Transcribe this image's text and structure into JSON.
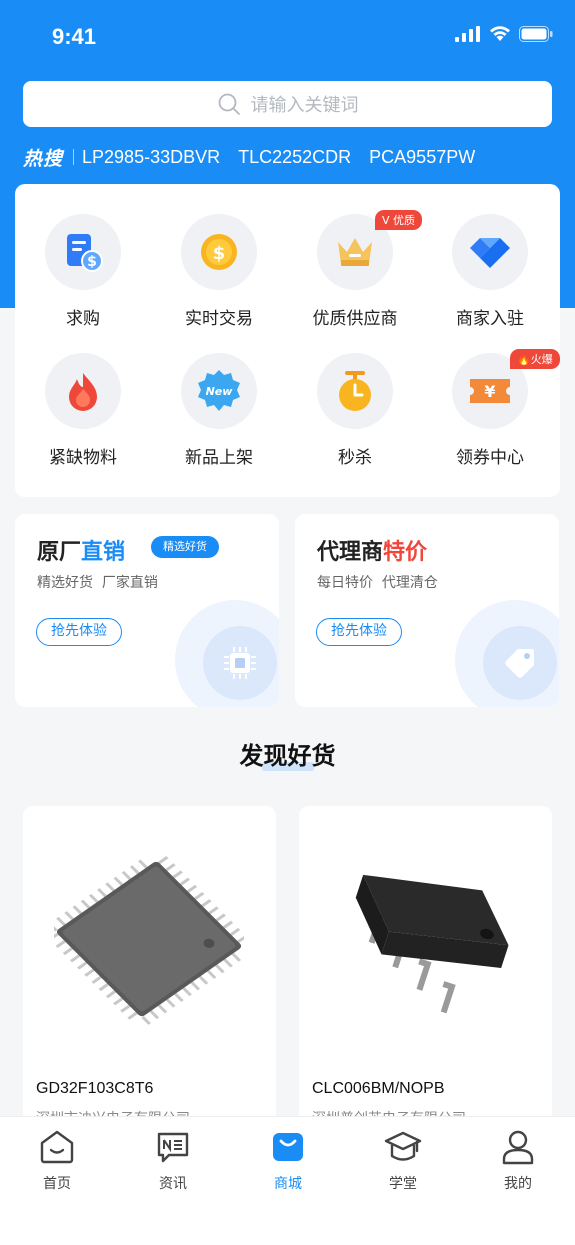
{
  "status": {
    "time": "9:41"
  },
  "search": {
    "placeholder": "请输入关键词"
  },
  "hot": {
    "label": "热搜",
    "items": [
      "LP2985-33DBVR",
      "TLC2252CDR",
      "PCA9557PW"
    ]
  },
  "categories": [
    {
      "label": "求购",
      "icon": "purchase-doc-icon"
    },
    {
      "label": "实时交易",
      "icon": "coin-icon"
    },
    {
      "label": "优质供应商",
      "icon": "crown-icon",
      "badge": "V 优质"
    },
    {
      "label": "商家入驻",
      "icon": "diamond-icon"
    },
    {
      "label": "紧缺物料",
      "icon": "flame-icon"
    },
    {
      "label": "新品上架",
      "icon": "new-badge-icon",
      "icon_text": "New"
    },
    {
      "label": "秒杀",
      "icon": "stopwatch-icon"
    },
    {
      "label": "领券中心",
      "icon": "coupon-icon",
      "badge": "火爆",
      "icon_text": "¥"
    }
  ],
  "promos": {
    "left": {
      "title_main": "原厂",
      "title_highlight": "直销",
      "tag": "精选好货",
      "subtitle": "精选好货  厂家直销",
      "button": "抢先体验"
    },
    "right": {
      "title_main": "代理商",
      "title_highlight": "特价",
      "subtitle": "每日特价  代理清仓",
      "button": "抢先体验"
    }
  },
  "section": {
    "title": "发现好货"
  },
  "products": [
    {
      "name": "GD32F103C8T6",
      "company": "深圳市迪兴电子有限公司"
    },
    {
      "name": "CLC006BM/NOPB",
      "company": "深圳普创芯电子有限公司"
    }
  ],
  "tabs": [
    {
      "label": "首页",
      "icon": "home-icon"
    },
    {
      "label": "资讯",
      "icon": "news-icon"
    },
    {
      "label": "商城",
      "icon": "shop-bag-icon",
      "active": true
    },
    {
      "label": "学堂",
      "icon": "graduation-cap-icon"
    },
    {
      "label": "我的",
      "icon": "user-icon"
    }
  ],
  "colors": {
    "primary": "#1a8cf5",
    "accent_red": "#f0473b",
    "background": "#f5f6f8"
  }
}
